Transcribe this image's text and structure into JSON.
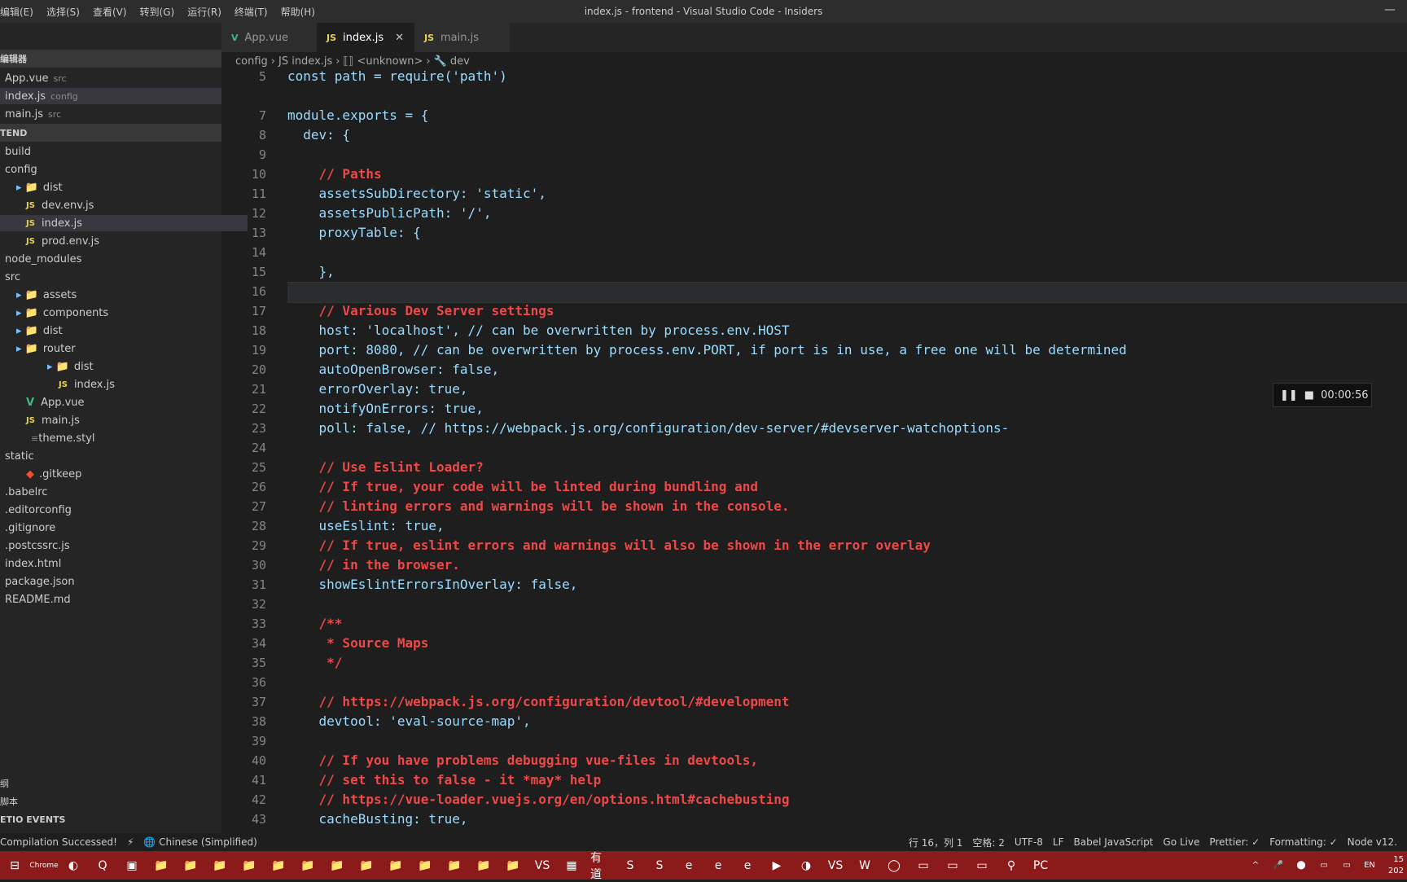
{
  "titlebar": {
    "menus": [
      "编辑(E)",
      "选择(S)",
      "查看(V)",
      "转到(G)",
      "运行(R)",
      "终端(T)",
      "帮助(H)"
    ],
    "title": "index.js - frontend - Visual Studio Code - Insiders",
    "minimize": "—"
  },
  "tabs": [
    {
      "icon": "V",
      "label": "App.vue"
    },
    {
      "icon": "JS",
      "label": "index.js",
      "close": "✕"
    },
    {
      "icon": "JS",
      "label": "main.js"
    }
  ],
  "breadcrumb": {
    "parts": [
      "config",
      "›",
      "JS index.js",
      "›",
      "⟦⟧ <unknown>",
      "›",
      "🔧 dev"
    ]
  },
  "sidebar": {
    "open_editors_header": "编辑器",
    "open_editors": [
      {
        "name": "App.vue",
        "hint": "src"
      },
      {
        "name": "index.js",
        "hint": "config"
      },
      {
        "name": "main.js",
        "hint": "src"
      }
    ],
    "project_header": "TEND",
    "tree": [
      {
        "name": "build",
        "type": "plain"
      },
      {
        "name": "config",
        "type": "plain"
      },
      {
        "name": "dist",
        "type": "folder"
      },
      {
        "name": "dev.env.js",
        "type": "js"
      },
      {
        "name": "index.js",
        "type": "js"
      },
      {
        "name": "prod.env.js",
        "type": "js"
      },
      {
        "name": "node_modules",
        "type": "plain"
      },
      {
        "name": "src",
        "type": "plain"
      },
      {
        "name": "assets",
        "type": "folder"
      },
      {
        "name": "components",
        "type": "folder"
      },
      {
        "name": "dist",
        "type": "folder"
      },
      {
        "name": "router",
        "type": "folder"
      },
      {
        "name": "dist",
        "type": "folder"
      },
      {
        "name": "index.js",
        "type": "js"
      },
      {
        "name": "App.vue",
        "type": "vue"
      },
      {
        "name": "main.js",
        "type": "js"
      },
      {
        "name": "theme.styl",
        "type": "file"
      },
      {
        "name": "static",
        "type": "plain"
      },
      {
        "name": ".gitkeep",
        "type": "git"
      },
      {
        "name": ".babelrc",
        "type": "plain"
      },
      {
        "name": ".editorconfig",
        "type": "plain"
      },
      {
        "name": ".gitignore",
        "type": "plain"
      },
      {
        "name": ".postcssrc.js",
        "type": "plain"
      },
      {
        "name": "index.html",
        "type": "plain"
      },
      {
        "name": "package.json",
        "type": "plain"
      },
      {
        "name": "README.md",
        "type": "plain"
      }
    ],
    "bottom_sections": [
      "纲",
      "脚本",
      "ETIO EVENTS"
    ]
  },
  "editor": {
    "line_numbers": [
      "5",
      "7",
      "8",
      "9",
      "10",
      "11",
      "12",
      "13",
      "14",
      "15",
      "16",
      "17",
      "18",
      "19",
      "20",
      "21",
      "22",
      "23",
      "24",
      "25",
      "26",
      "27",
      "28",
      "29",
      "30",
      "31",
      "32",
      "33",
      "34",
      "35",
      "36",
      "37",
      "38",
      "39",
      "40",
      "41",
      "42",
      "43"
    ],
    "lines": [
      "const path = require('path')",
      "module.exports = {",
      "  dev: {",
      "",
      "    // Paths",
      "    assetsSubDirectory: 'static',",
      "    assetsPublicPath: '/',",
      "    proxyTable: {",
      "",
      "    },",
      "",
      "    // Various Dev Server settings",
      "    host: 'localhost', // can be overwritten by process.env.HOST",
      "    port: 8080, // can be overwritten by process.env.PORT, if port is in use, a free one will be determined",
      "    autoOpenBrowser: false,",
      "    errorOverlay: true,",
      "    notifyOnErrors: true,",
      "    poll: false, // https://webpack.js.org/configuration/dev-server/#devserver-watchoptions-",
      "",
      "    // Use Eslint Loader?",
      "    // If true, your code will be linted during bundling and",
      "    // linting errors and warnings will be shown in the console.",
      "    useEslint: true,",
      "    // If true, eslint errors and warnings will also be shown in the error overlay",
      "    // in the browser.",
      "    showEslintErrorsInOverlay: false,",
      "",
      "    /**",
      "     * Source Maps",
      "     */",
      "",
      "    // https://webpack.js.org/configuration/devtool/#development",
      "    devtool: 'eval-source-map',",
      "",
      "    // If you have problems debugging vue-files in devtools,",
      "    // set this to false - it *may* help",
      "    // https://vue-loader.vuejs.org/en/options.html#cachebusting",
      "    cacheBusting: true,"
    ]
  },
  "recorder": {
    "time": "00:00:56",
    "pause": "❚❚",
    "stop": "■"
  },
  "statusbar": {
    "left": [
      "Compilation Successed!",
      "⚡",
      "🌐 Chinese (Simplified)"
    ],
    "right": [
      "行 16，列 1",
      "空格: 2",
      "UTF-8",
      "LF",
      "Babel JavaScript",
      "Go Live",
      "Prettier: ✓",
      "Formatting: ✓",
      "Node v12."
    ]
  },
  "taskbar": {
    "start": "⊟",
    "apps": [
      "Chrome",
      "◐",
      "Q",
      "▣",
      "📁",
      "📁",
      "📁",
      "📁",
      "📁",
      "📁",
      "📁",
      "📁",
      "📁",
      "📁",
      "📁",
      "📁",
      "📁",
      "VS",
      "▦",
      "有道",
      "S",
      "S",
      "e",
      "e",
      "e",
      "▶",
      "◑",
      "VS",
      "W",
      "◯",
      "▭",
      "▭",
      "▭",
      "⚲",
      "PC"
    ],
    "tray": [
      "^",
      "🎤",
      "⬤",
      "▭",
      "▭",
      "EN"
    ],
    "clock": "15",
    "date": "202"
  },
  "colors": {
    "accent": "#007acc",
    "taskbar": "#8b1a1a",
    "comment": "#ef4848",
    "string": "#ce9178"
  }
}
